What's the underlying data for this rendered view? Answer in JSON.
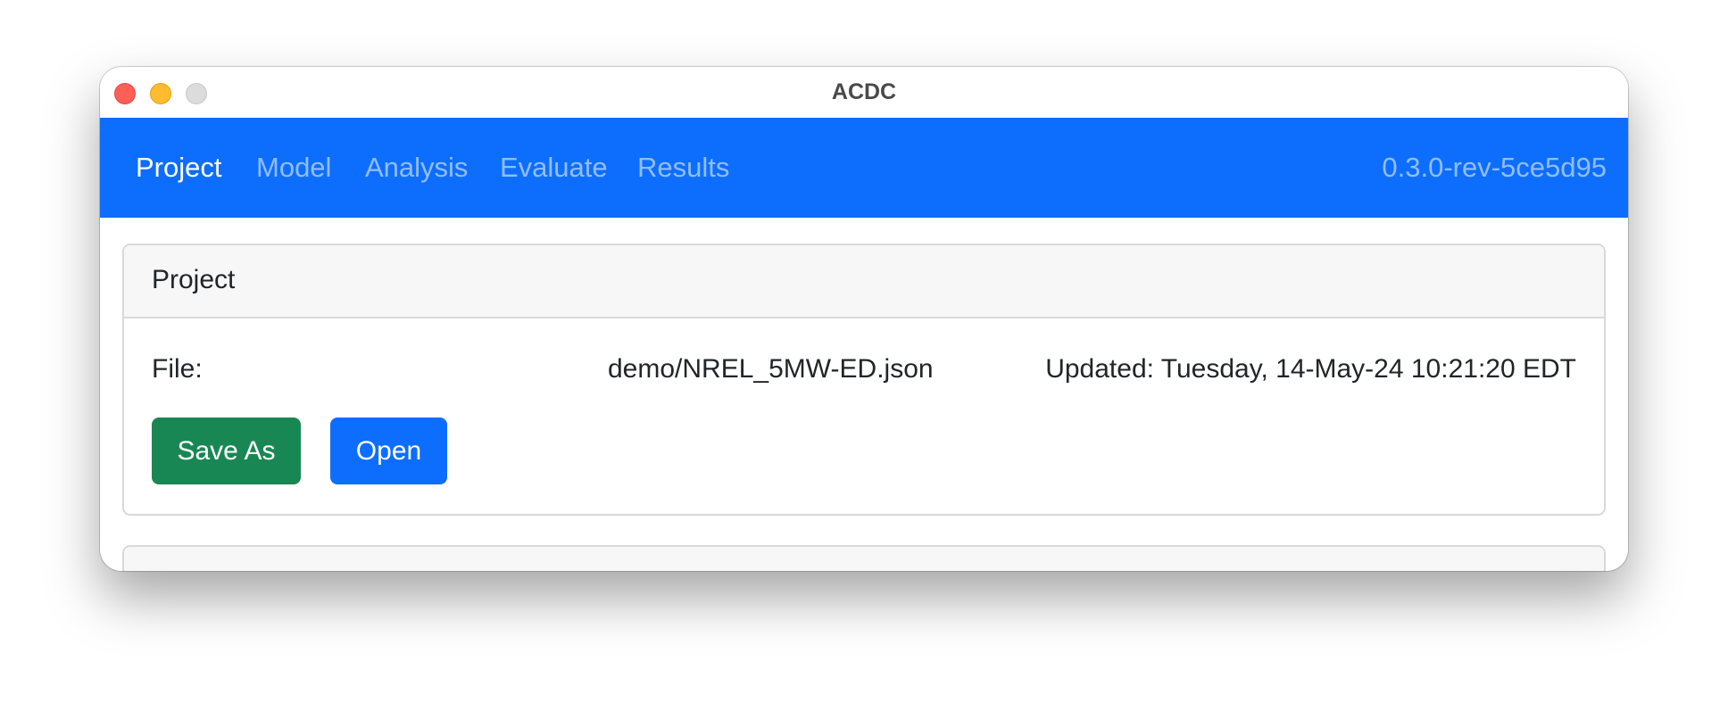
{
  "window": {
    "title": "ACDC"
  },
  "navbar": {
    "tabs": [
      {
        "label": "Project",
        "active": true
      },
      {
        "label": "Model",
        "active": false
      },
      {
        "label": "Analysis",
        "active": false
      },
      {
        "label": "Evaluate",
        "active": false
      },
      {
        "label": "Results",
        "active": false
      }
    ],
    "version": "0.3.0-rev-5ce5d95",
    "color": "#0d6efd"
  },
  "project_card": {
    "header": "Project",
    "file_label": "File:",
    "file_path": "demo/NREL_5MW-ED.json",
    "updated": "Updated: Tuesday, 14-May-24 10:21:20 EDT",
    "buttons": {
      "save_as": "Save As",
      "open": "Open"
    }
  },
  "colors": {
    "save_button": "#198754",
    "open_button": "#0d6efd",
    "traffic_close": "#ff5f57",
    "traffic_minimize": "#febc2e",
    "traffic_zoom": "#dcdcdc"
  },
  "icons": {
    "close": "close-window-icon",
    "minimize": "minimize-window-icon",
    "zoom": "zoom-window-icon"
  }
}
